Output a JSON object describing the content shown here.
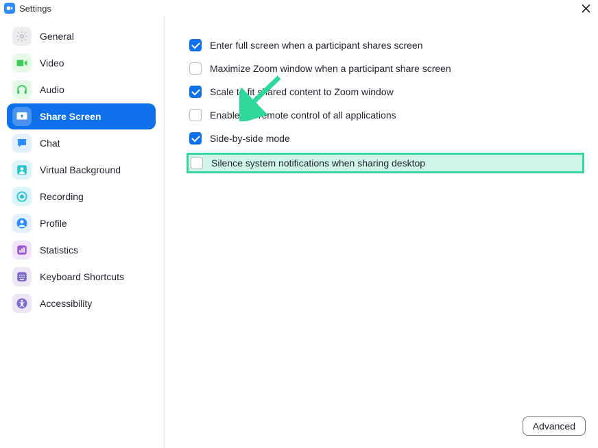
{
  "window": {
    "title": "Settings"
  },
  "sidebar": {
    "items": [
      {
        "label": "General",
        "icon": "gear-icon",
        "iconBg": "#EDEDF0",
        "iconFill": "#b8b8c2"
      },
      {
        "label": "Video",
        "icon": "video-icon",
        "iconBg": "#E6F9E8",
        "iconFill": "#3CCB5A"
      },
      {
        "label": "Audio",
        "icon": "headphones-icon",
        "iconBg": "#E6F9E8",
        "iconFill": "#3CCB5A"
      },
      {
        "label": "Share Screen",
        "icon": "share-screen-icon",
        "iconBg": "#2D8CFF",
        "iconFill": "#ffffff",
        "active": true
      },
      {
        "label": "Chat",
        "icon": "chat-icon",
        "iconBg": "#E4F0FF",
        "iconFill": "#2D8CFF"
      },
      {
        "label": "Virtual Background",
        "icon": "virtual-bg-icon",
        "iconBg": "#DAF4F8",
        "iconFill": "#28C4D6"
      },
      {
        "label": "Recording",
        "icon": "record-icon",
        "iconBg": "#DAF4F8",
        "iconFill": "#28C4D6"
      },
      {
        "label": "Profile",
        "icon": "profile-icon",
        "iconBg": "#E4F0FF",
        "iconFill": "#2D8CFF"
      },
      {
        "label": "Statistics",
        "icon": "stats-icon",
        "iconBg": "#F2E4FB",
        "iconFill": "#9B59D6"
      },
      {
        "label": "Keyboard Shortcuts",
        "icon": "keyboard-icon",
        "iconBg": "#ECE6F7",
        "iconFill": "#7B6BCF"
      },
      {
        "label": "Accessibility",
        "icon": "accessibility-icon",
        "iconBg": "#ECE6F7",
        "iconFill": "#7B6BCF"
      }
    ]
  },
  "options": [
    {
      "label": "Enter full screen when a participant shares screen",
      "checked": true
    },
    {
      "label": "Maximize Zoom window when a participant share screen",
      "checked": false
    },
    {
      "label": "Scale to fit shared content to Zoom window",
      "checked": true
    },
    {
      "label": "Enable the remote control of all applications",
      "checked": false
    },
    {
      "label": "Side-by-side mode",
      "checked": true
    },
    {
      "label": "Silence system notifications when sharing desktop",
      "checked": false,
      "highlighted": true
    }
  ],
  "buttons": {
    "advanced": "Advanced"
  },
  "annotation": {
    "arrowColor": "#2FD89A"
  }
}
